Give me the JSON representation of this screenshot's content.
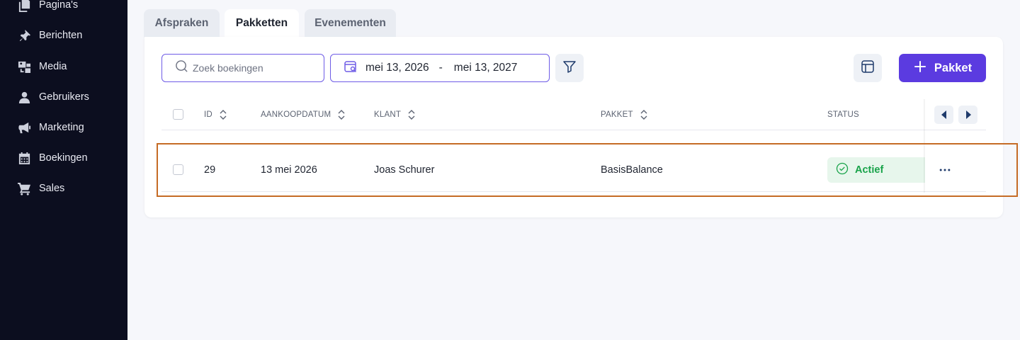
{
  "sidebar": {
    "items": [
      {
        "label": "Pagina's",
        "icon": "pages-icon"
      },
      {
        "label": "Berichten",
        "icon": "pin-icon"
      },
      {
        "label": "Media",
        "icon": "media-icon"
      },
      {
        "label": "Gebruikers",
        "icon": "user-icon"
      },
      {
        "label": "Marketing",
        "icon": "megaphone-icon"
      },
      {
        "label": "Boekingen",
        "icon": "calendar-icon"
      },
      {
        "label": "Sales",
        "icon": "cart-icon"
      }
    ]
  },
  "tabs": [
    {
      "label": "Afspraken",
      "active": false
    },
    {
      "label": "Pakketten",
      "active": true
    },
    {
      "label": "Evenementen",
      "active": false
    }
  ],
  "toolbar": {
    "search_placeholder": "Zoek boekingen",
    "date_from": "mei 13, 2026",
    "date_separator": "-",
    "date_to": "mei 13, 2027",
    "filter_icon": "filter-icon",
    "columns_icon": "columns-icon",
    "add_label": "Pakket"
  },
  "table": {
    "columns": [
      "ID",
      "AANKOOPDATUM",
      "KLANT",
      "PAKKET",
      "STATUS"
    ],
    "rows": [
      {
        "id": "29",
        "date": "13 mei 2026",
        "client": "Joas Schurer",
        "package": "BasisBalance",
        "status": "Actief"
      }
    ]
  },
  "colors": {
    "sidebar_bg": "#0c0e1f",
    "accent": "#5b3be0",
    "status_green": "#19a34a",
    "highlight": "#c56b25"
  }
}
